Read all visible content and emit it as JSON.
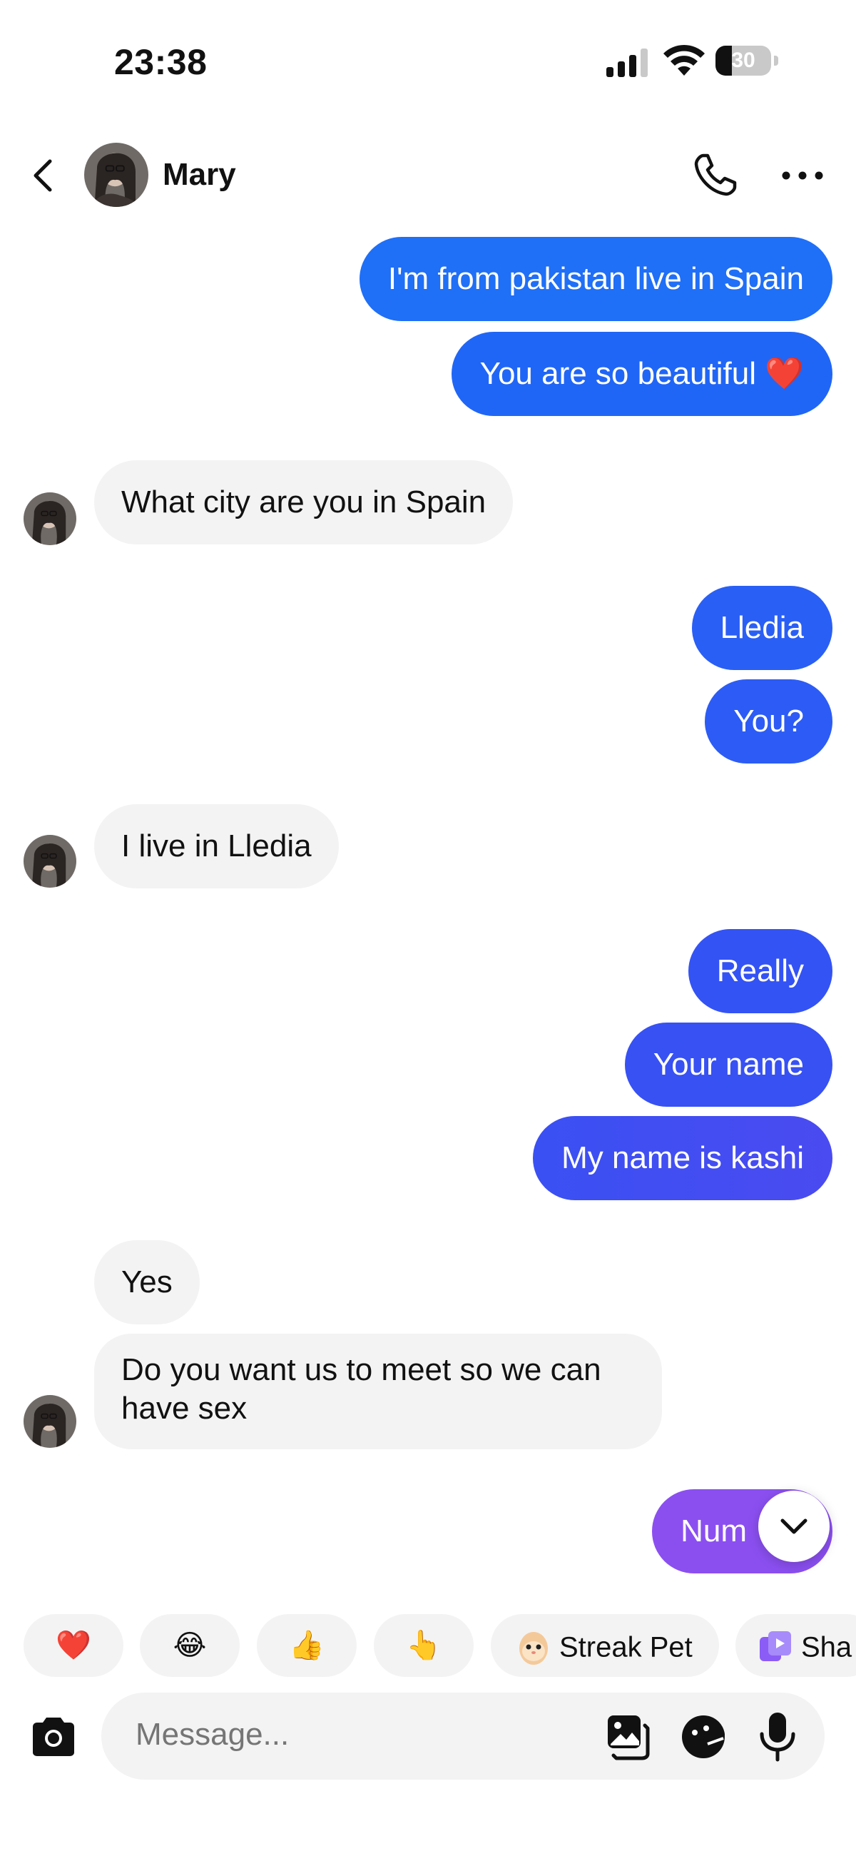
{
  "status_bar": {
    "time": "23:38",
    "battery": "30",
    "battery_level": 0.3
  },
  "header": {
    "contact_name": "Mary"
  },
  "messages": [
    {
      "side": "out",
      "text": "I'm from pakistan live in Spain"
    },
    {
      "side": "out",
      "text": "You are so beautiful ❤️"
    },
    {
      "side": "in",
      "text": "What city are you in Spain"
    },
    {
      "side": "out",
      "text": "Lledia"
    },
    {
      "side": "out",
      "text": "You?"
    },
    {
      "side": "in",
      "text": "I live in Lledia"
    },
    {
      "side": "out",
      "text": "Really"
    },
    {
      "side": "out",
      "text": "Your name"
    },
    {
      "side": "out",
      "text": "My name is kashi"
    },
    {
      "side": "in",
      "text": "Yes"
    },
    {
      "side": "in",
      "text": "Do you want us to meet so we can have sex"
    },
    {
      "side": "out",
      "text": "Num"
    }
  ],
  "quick_replies": [
    {
      "label": "❤️",
      "icon": "heart-emoji"
    },
    {
      "label": "😂",
      "icon": "laughing-emoji"
    },
    {
      "label": "👍",
      "icon": "thumbs-up-emoji"
    },
    {
      "label": "👆",
      "icon": "pointing-up-emoji"
    },
    {
      "label": "Streak Pet",
      "icon": "streak-pet-icon"
    },
    {
      "label": "Sha",
      "icon": "share-icon"
    }
  ],
  "composer": {
    "placeholder": "Message..."
  },
  "colors": {
    "bubble_gradient": [
      "#1f6ff7",
      "#3457f4",
      "#4a4bf0",
      "#8b4ff0"
    ],
    "incoming_bubble": "#f3f3f3"
  }
}
